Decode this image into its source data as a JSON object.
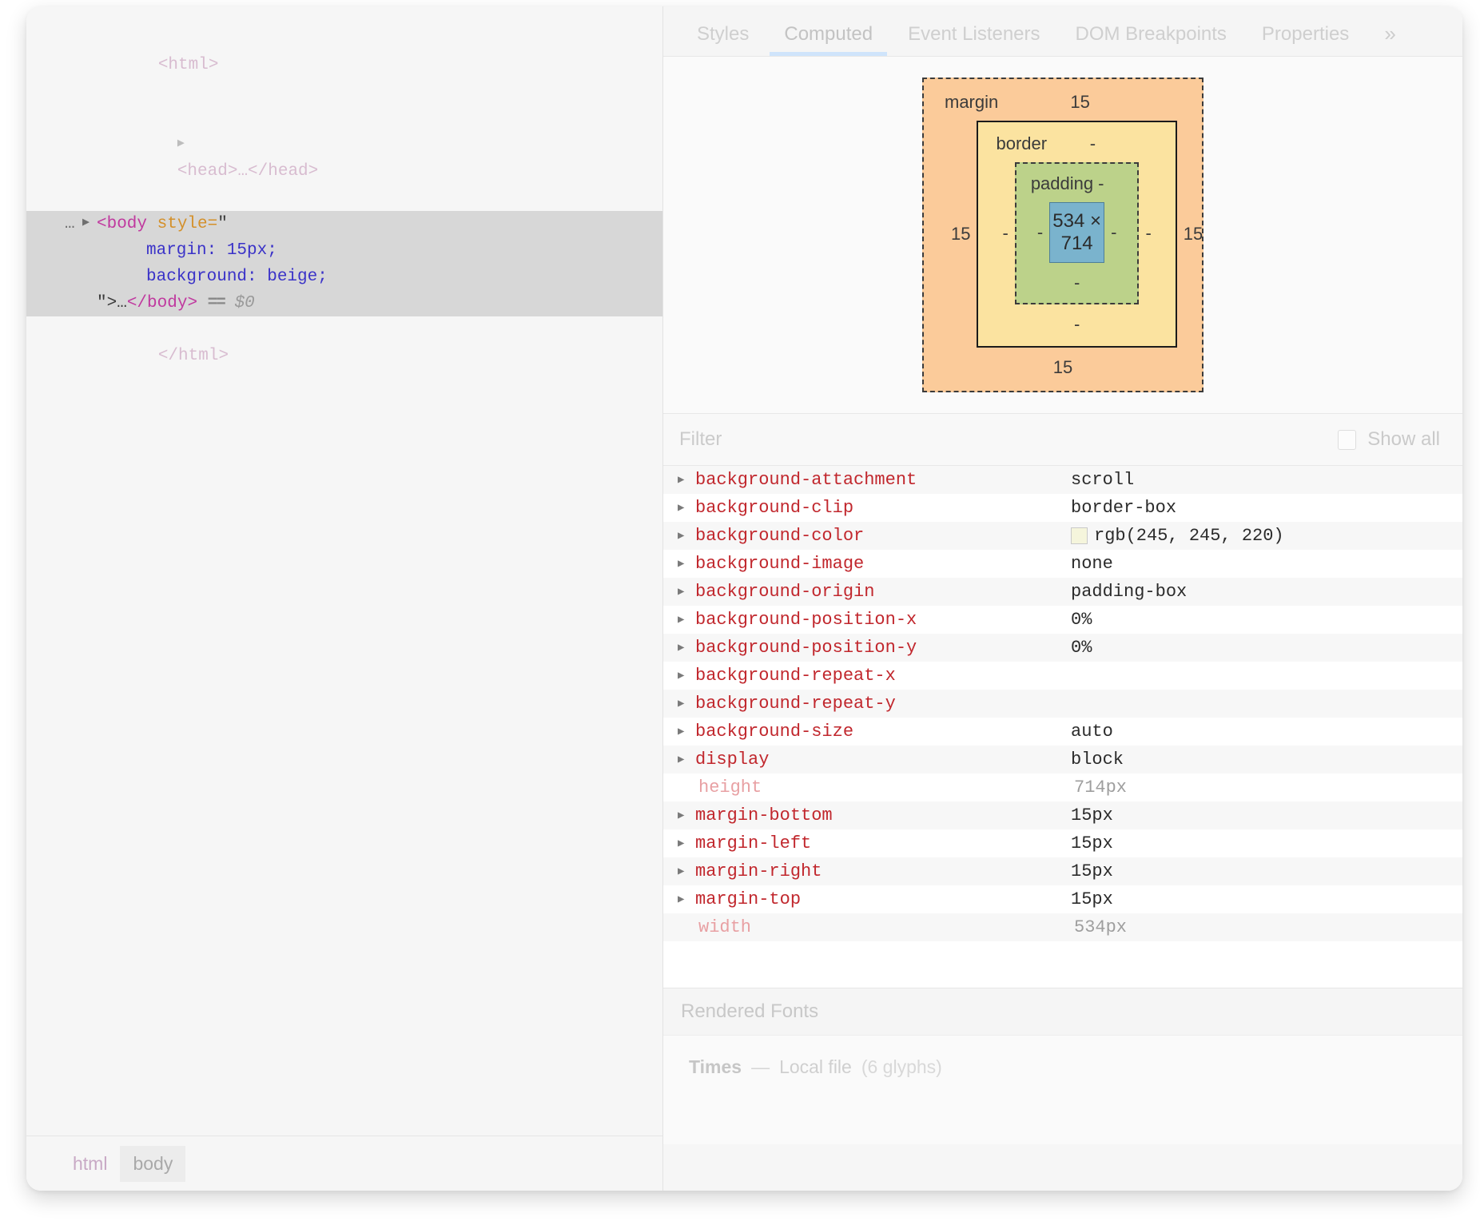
{
  "dom_tree": {
    "lines": [
      {
        "kind": "plain_html_open",
        "text": "<html>"
      },
      {
        "kind": "head",
        "arrow": "▶",
        "text": "<head>…</head>"
      },
      {
        "kind": "selected_open",
        "gutter": "…",
        "arrow": "▶",
        "tag": "<body",
        "attr": " style=",
        "quote": "\""
      },
      {
        "kind": "style_prop",
        "text": "margin: 15px;"
      },
      {
        "kind": "style_prop",
        "text": "background: beige;"
      },
      {
        "kind": "selected_close",
        "quote": "\">",
        "ellipsis": "…",
        "tag": "</body>",
        "eq": "==",
        "dollar": "$0"
      },
      {
        "kind": "plain_html_close",
        "text": "</html>"
      }
    ],
    "breadcrumb": [
      {
        "label": "html",
        "active": false
      },
      {
        "label": "body",
        "active": true
      }
    ]
  },
  "tabs": [
    {
      "label": "Styles",
      "selected": false
    },
    {
      "label": "Computed",
      "selected": true
    },
    {
      "label": "Event Listeners",
      "selected": false
    },
    {
      "label": "DOM Breakpoints",
      "selected": false
    },
    {
      "label": "Properties",
      "selected": false
    }
  ],
  "tabs_overflow_icon": "»",
  "box_model": {
    "margin_label": "margin",
    "margin_top": "15",
    "margin_right": "15",
    "margin_bottom": "15",
    "margin_left": "15",
    "border_label": "border",
    "border_top": "-",
    "border_right": "-",
    "border_bottom": "-",
    "border_left": "-",
    "padding_label": "padding",
    "padding_top": "-",
    "padding_right": "-",
    "padding_bottom": "-",
    "padding_left": "-",
    "content_size": "534 × 714",
    "colors": {
      "margin": "#fbcb9a",
      "border": "#fbe3a0",
      "padding": "#bcd28a",
      "content": "#7ab3cd"
    }
  },
  "filter": {
    "placeholder": "Filter",
    "value": "",
    "show_all_label": "Show all",
    "show_all_checked": false
  },
  "properties": [
    {
      "name": "background-attachment",
      "value": "scroll",
      "expandable": true,
      "inherited": false,
      "swatch": null
    },
    {
      "name": "background-clip",
      "value": "border-box",
      "expandable": true,
      "inherited": false,
      "swatch": null
    },
    {
      "name": "background-color",
      "value": "rgb(245, 245, 220)",
      "expandable": true,
      "inherited": false,
      "swatch": "rgb(245, 245, 220)"
    },
    {
      "name": "background-image",
      "value": "none",
      "expandable": true,
      "inherited": false,
      "swatch": null
    },
    {
      "name": "background-origin",
      "value": "padding-box",
      "expandable": true,
      "inherited": false,
      "swatch": null
    },
    {
      "name": "background-position-x",
      "value": "0%",
      "expandable": true,
      "inherited": false,
      "swatch": null
    },
    {
      "name": "background-position-y",
      "value": "0%",
      "expandable": true,
      "inherited": false,
      "swatch": null
    },
    {
      "name": "background-repeat-x",
      "value": "",
      "expandable": true,
      "inherited": false,
      "swatch": null
    },
    {
      "name": "background-repeat-y",
      "value": "",
      "expandable": true,
      "inherited": false,
      "swatch": null
    },
    {
      "name": "background-size",
      "value": "auto",
      "expandable": true,
      "inherited": false,
      "swatch": null
    },
    {
      "name": "display",
      "value": "block",
      "expandable": true,
      "inherited": false,
      "swatch": null
    },
    {
      "name": "height",
      "value": "714px",
      "expandable": false,
      "inherited": true,
      "swatch": null
    },
    {
      "name": "margin-bottom",
      "value": "15px",
      "expandable": true,
      "inherited": false,
      "swatch": null
    },
    {
      "name": "margin-left",
      "value": "15px",
      "expandable": true,
      "inherited": false,
      "swatch": null
    },
    {
      "name": "margin-right",
      "value": "15px",
      "expandable": true,
      "inherited": false,
      "swatch": null
    },
    {
      "name": "margin-top",
      "value": "15px",
      "expandable": true,
      "inherited": false,
      "swatch": null
    },
    {
      "name": "width",
      "value": "534px",
      "expandable": false,
      "inherited": true,
      "swatch": null
    }
  ],
  "rendered_fonts": {
    "header": "Rendered Fonts",
    "name": "Times",
    "dash": "—",
    "source": "Local file",
    "glyphs": "(6 glyphs)"
  }
}
